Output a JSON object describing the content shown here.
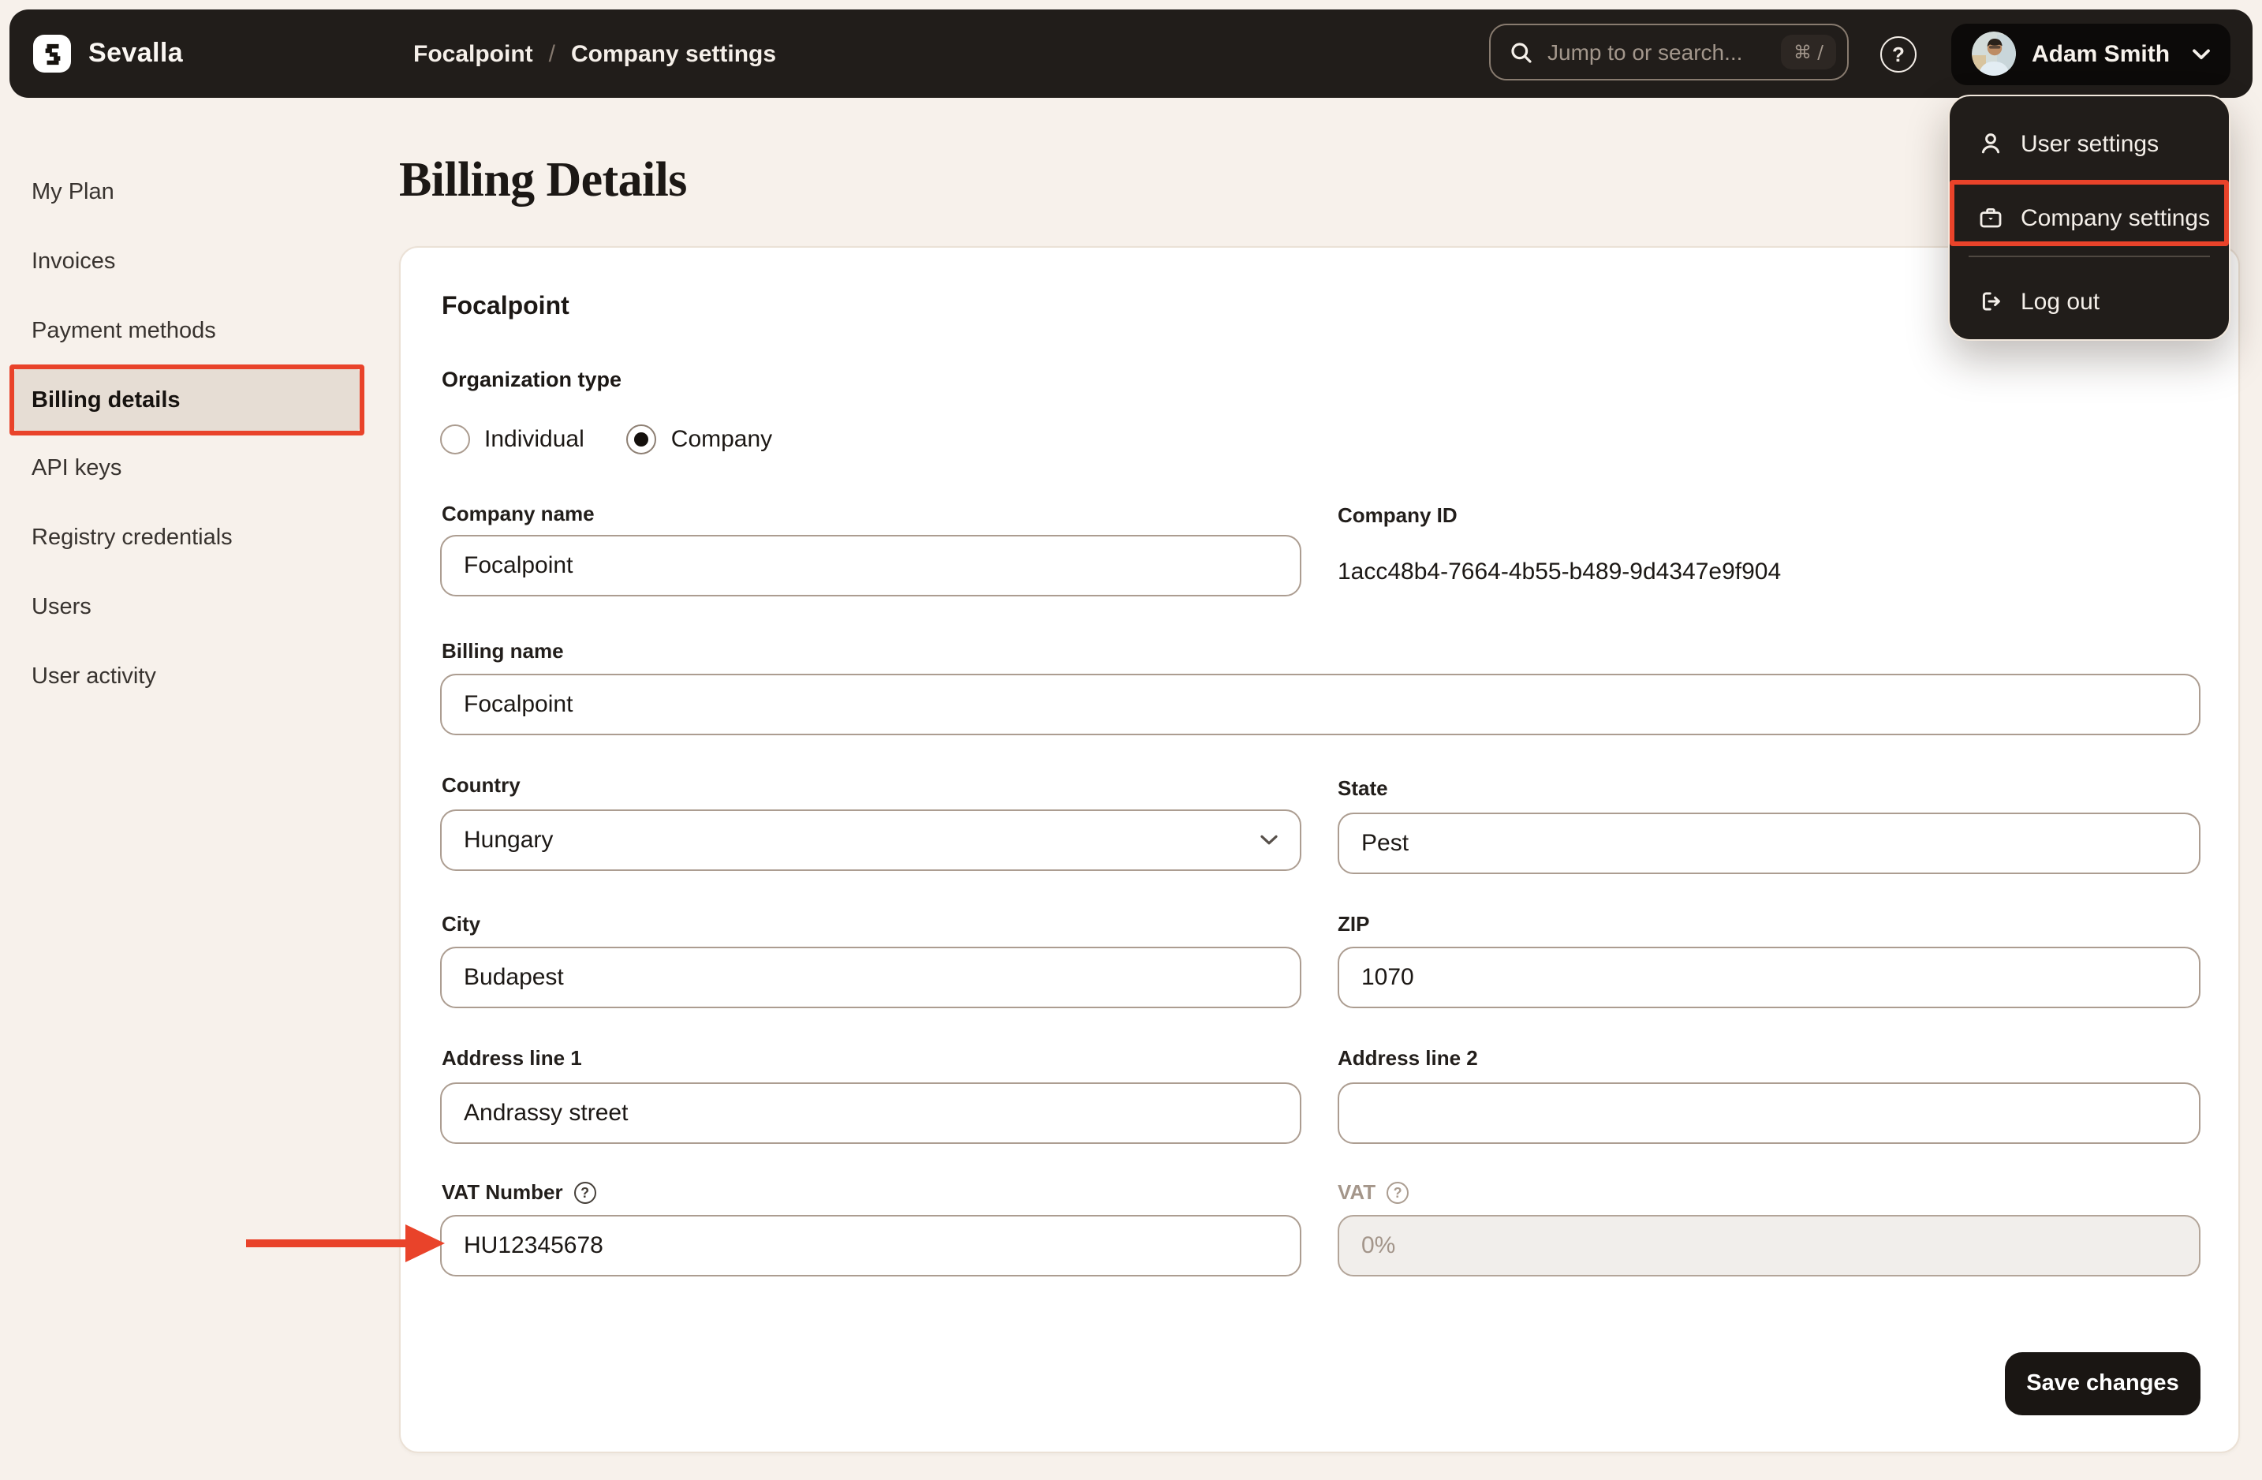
{
  "topbar": {
    "brand": "Sevalla",
    "breadcrumb": {
      "parent": "Focalpoint",
      "separator": "/",
      "current": "Company settings"
    },
    "search": {
      "placeholder": "Jump to or search...",
      "shortcut": "⌘ /"
    },
    "help_glyph": "?",
    "user": {
      "name": "Adam Smith"
    }
  },
  "user_menu": {
    "items": [
      {
        "label": "User settings",
        "icon": "user-icon",
        "highlighted": false
      },
      {
        "label": "Company settings",
        "icon": "briefcase-icon",
        "highlighted": true
      },
      {
        "label": "Log out",
        "icon": "logout-icon",
        "highlighted": false
      }
    ]
  },
  "sidebar": {
    "items": [
      {
        "label": "My Plan",
        "active": false
      },
      {
        "label": "Invoices",
        "active": false
      },
      {
        "label": "Payment methods",
        "active": false
      },
      {
        "label": "Billing details",
        "active": true
      },
      {
        "label": "API keys",
        "active": false
      },
      {
        "label": "Registry credentials",
        "active": false
      },
      {
        "label": "Users",
        "active": false
      },
      {
        "label": "User activity",
        "active": false
      }
    ]
  },
  "page": {
    "title": "Billing Details"
  },
  "form": {
    "company_title": "Focalpoint",
    "organization_type": {
      "label": "Organization type",
      "options": [
        {
          "label": "Individual",
          "selected": false
        },
        {
          "label": "Company",
          "selected": true
        }
      ]
    },
    "fields": {
      "company_name": {
        "label": "Company name",
        "value": "Focalpoint"
      },
      "company_id": {
        "label": "Company ID",
        "value": "1acc48b4-7664-4b55-b489-9d4347e9f904"
      },
      "billing_name": {
        "label": "Billing name",
        "value": "Focalpoint"
      },
      "country": {
        "label": "Country",
        "value": "Hungary"
      },
      "state": {
        "label": "State",
        "value": "Pest"
      },
      "city": {
        "label": "City",
        "value": "Budapest"
      },
      "zip": {
        "label": "ZIP",
        "value": "1070"
      },
      "address1": {
        "label": "Address line 1",
        "value": "Andrassy street"
      },
      "address2": {
        "label": "Address line 2",
        "value": ""
      },
      "vat_number": {
        "label": "VAT Number",
        "value": "HU12345678"
      },
      "vat": {
        "label": "VAT",
        "value": "0%",
        "disabled": true
      }
    },
    "save_label": "Save changes"
  },
  "colors": {
    "annotation_red": "#e9432a",
    "topbar_bg": "#211d1a",
    "page_bg": "#f7f1eb",
    "active_pill_bg": "#e6ddd4",
    "input_border": "#ac9d91"
  }
}
